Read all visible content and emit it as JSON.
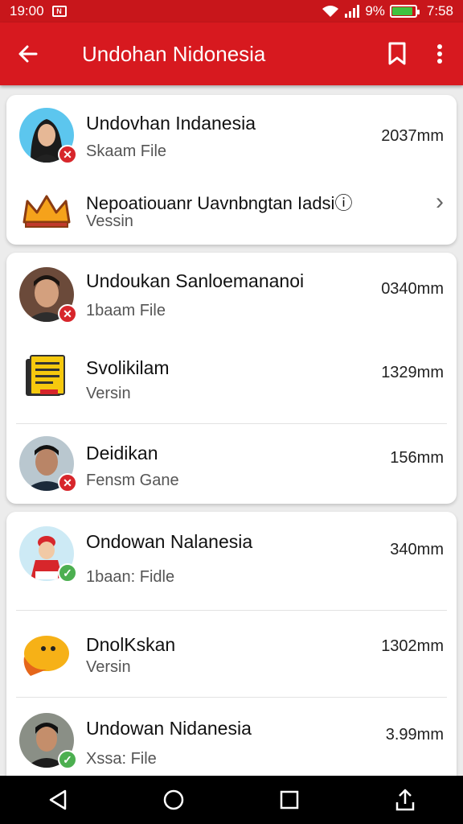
{
  "status_bar": {
    "time": "19:00",
    "notif_label": "N",
    "battery_percent": "9%",
    "clock_right": "7:58",
    "battery_level": 0.9
  },
  "app_bar": {
    "title": "Undohan Nidonesia"
  },
  "cards": [
    {
      "rows": [
        {
          "title": "Undovhan Indanesia",
          "subtitle": "Skaam File",
          "size": "2037mm",
          "badge": "red"
        },
        {
          "title": "Nepoatiouanr Uavnbngtan Iadsiⓘ",
          "subtitle": "Vessin",
          "size": "",
          "chevron": "›"
        }
      ]
    },
    {
      "rows": [
        {
          "title": "Undoukan Sanloemananoi",
          "subtitle": "1baam File",
          "size": "0340mm",
          "badge": "red"
        },
        {
          "title": "Svolikilam",
          "subtitle": "Versin",
          "size": "1329mm"
        },
        {
          "title": "Deidikan",
          "subtitle": "Fensm Gane",
          "size": "156mm",
          "badge": "red"
        }
      ]
    },
    {
      "rows": [
        {
          "title": "Ondowan Nalanesia",
          "subtitle": "1baan: Fidle",
          "size": "340mm",
          "badge": "green"
        },
        {
          "title": "DnolKskan",
          "subtitle": "Versin",
          "size": "1302mm"
        },
        {
          "title": "Undowan Nidanesia",
          "subtitle": "Xssa: File",
          "size": "3.99mm",
          "badge": "green"
        }
      ]
    }
  ],
  "colors": {
    "accent": "#d7191f",
    "status_bar": "#c8161b",
    "badge_red": "#d7262b",
    "badge_green": "#4caf50"
  },
  "icons": {
    "back": "arrow-left-icon",
    "bookmark": "bookmark-icon",
    "more": "more-vert-icon"
  }
}
